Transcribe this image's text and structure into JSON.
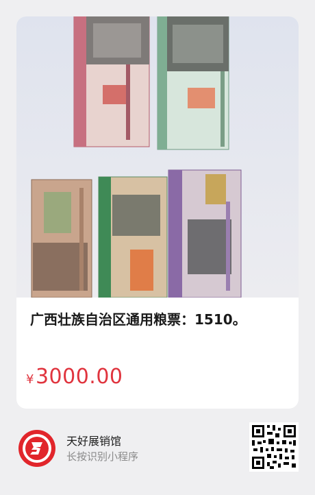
{
  "product": {
    "title": "广西壮族自治区通用粮票：1510。",
    "price_symbol": "¥",
    "price_value": "3000.00"
  },
  "store": {
    "name": "天好展销馆",
    "hint": "长按识别小程序"
  },
  "colors": {
    "price": "#e0343e",
    "logo_red": "#e1252b"
  }
}
